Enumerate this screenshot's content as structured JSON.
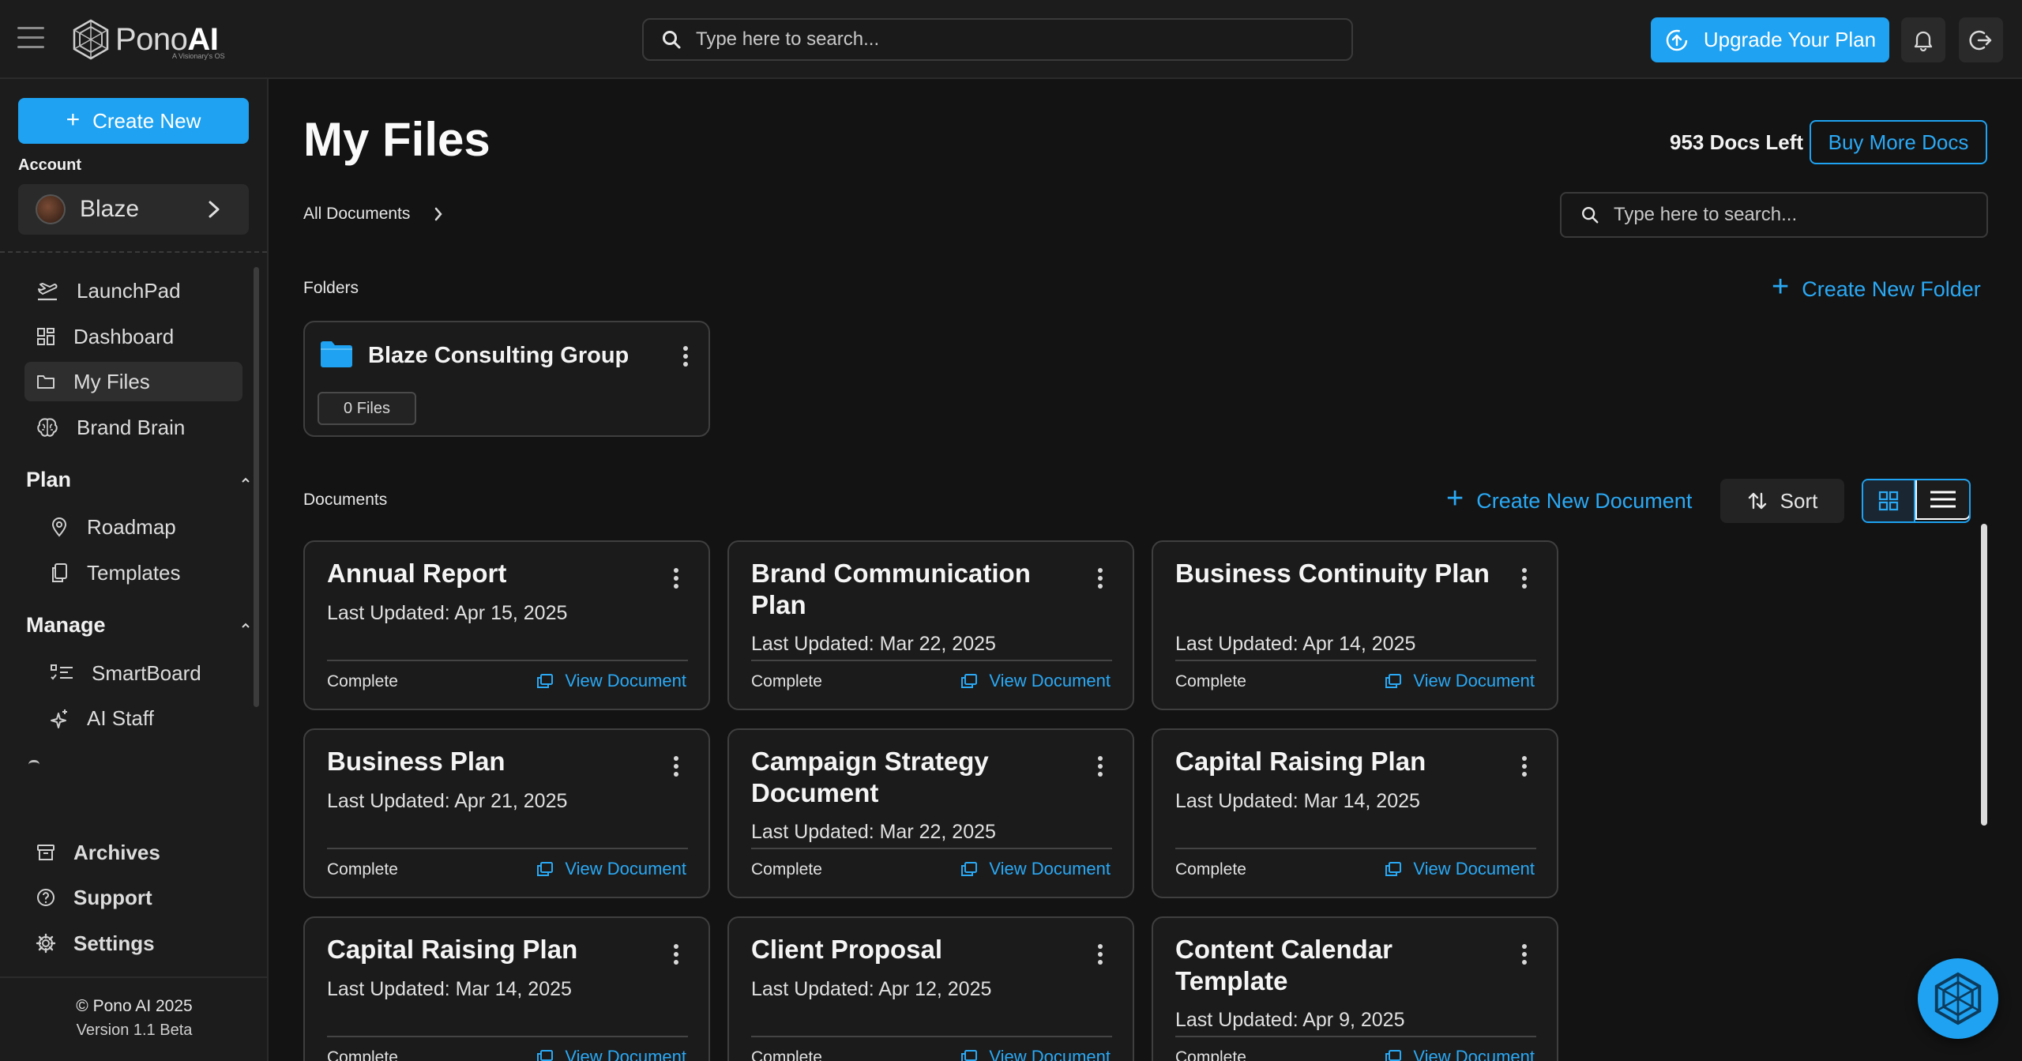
{
  "topbar": {
    "brand": {
      "name_light": "Pono",
      "name_bold": "AI",
      "tagline": "A Visionary's OS"
    },
    "search_placeholder": "Type here to search...",
    "upgrade_label": "Upgrade Your Plan"
  },
  "sidebar": {
    "create_label": "Create New",
    "account_label": "Account",
    "account_name": "Blaze",
    "nav": [
      {
        "label": "LaunchPad",
        "icon": "plane-takeoff-icon"
      },
      {
        "label": "Dashboard",
        "icon": "dashboard-grid-icon"
      },
      {
        "label": "My Files",
        "icon": "folder-icon",
        "active": true
      },
      {
        "label": "Brand Brain",
        "icon": "brain-icon"
      }
    ],
    "plan": {
      "label": "Plan",
      "items": [
        {
          "label": "Roadmap",
          "icon": "map-pin-icon"
        },
        {
          "label": "Templates",
          "icon": "copy-icon"
        }
      ]
    },
    "manage": {
      "label": "Manage",
      "items": [
        {
          "label": "SmartBoard",
          "icon": "checklist-icon"
        },
        {
          "label": "AI Staff",
          "icon": "sparkle-icon"
        }
      ]
    },
    "bottom": [
      {
        "label": "Archives",
        "icon": "archive-icon"
      },
      {
        "label": "Support",
        "icon": "help-circle-icon"
      },
      {
        "label": "Settings",
        "icon": "gear-icon"
      }
    ],
    "copyright": "© Pono AI 2025",
    "version": "Version 1.1 Beta"
  },
  "main": {
    "title": "My Files",
    "docs_left": "953 Docs Left",
    "buy_label": "Buy More Docs",
    "breadcrumb": "All Documents",
    "search_placeholder": "Type here to search...",
    "folders_label": "Folders",
    "create_folder_label": "Create New Folder",
    "folder": {
      "name": "Blaze Consulting Group",
      "count": "0 Files"
    },
    "documents_label": "Documents",
    "create_document_label": "Create New Document",
    "sort_label": "Sort",
    "view_mode": "grid",
    "documents": [
      {
        "title": "Annual Report",
        "updated": "Last Updated: Apr 15, 2025",
        "status": "Complete",
        "action": "View Document"
      },
      {
        "title": "Brand Communication Plan",
        "updated": "Last Updated: Mar 22, 2025",
        "status": "Complete",
        "action": "View Document"
      },
      {
        "title": "Business Continuity Plan",
        "updated": "Last Updated: Apr 14, 2025",
        "status": "Complete",
        "action": "View Document"
      },
      {
        "title": "Business Plan",
        "updated": "Last Updated: Apr 21, 2025",
        "status": "Complete",
        "action": "View Document"
      },
      {
        "title": "Campaign Strategy Document",
        "updated": "Last Updated: Mar 22, 2025",
        "status": "Complete",
        "action": "View Document"
      },
      {
        "title": "Capital Raising Plan",
        "updated": "Last Updated: Mar 14, 2025",
        "status": "Complete",
        "action": "View Document"
      },
      {
        "title": "Capital Raising Plan",
        "updated": "Last Updated: Mar 14, 2025",
        "status": "Complete",
        "action": "View Document"
      },
      {
        "title": "Client Proposal",
        "updated": "Last Updated: Apr 12, 2025",
        "status": "Complete",
        "action": "View Document"
      },
      {
        "title": "Content Calendar Template",
        "updated": "Last Updated: Apr 9, 2025",
        "status": "Complete",
        "action": "View Document"
      }
    ]
  },
  "colors": {
    "accent": "#1ea2f1",
    "background": "#131313",
    "surface": "#1c1c1c",
    "card_border": "#3f3f3f"
  }
}
